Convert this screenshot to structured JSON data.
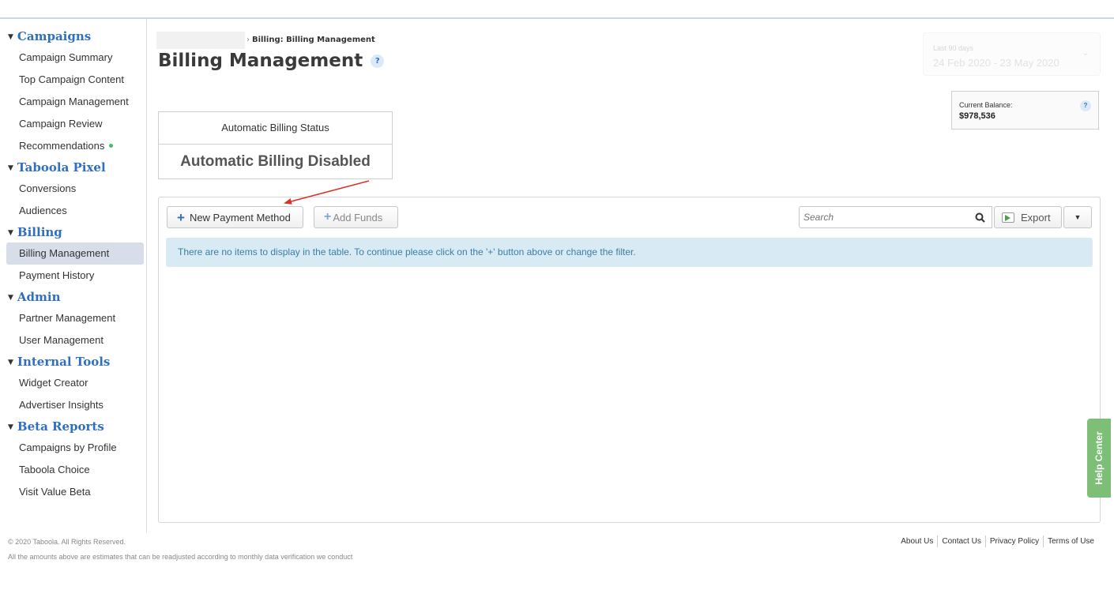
{
  "sidebar": {
    "sections": [
      {
        "title": "Campaigns",
        "items": [
          {
            "label": "Campaign Summary"
          },
          {
            "label": "Top Campaign Content"
          },
          {
            "label": "Campaign Management"
          },
          {
            "label": "Campaign Review"
          },
          {
            "label": "Recommendations"
          }
        ]
      },
      {
        "title": "Taboola Pixel",
        "items": [
          {
            "label": "Conversions"
          },
          {
            "label": "Audiences"
          }
        ]
      },
      {
        "title": "Billing",
        "items": [
          {
            "label": "Billing Management"
          },
          {
            "label": "Payment History"
          }
        ]
      },
      {
        "title": "Admin",
        "items": [
          {
            "label": "Partner Management"
          },
          {
            "label": "User Management"
          }
        ]
      },
      {
        "title": "Internal Tools",
        "items": [
          {
            "label": "Widget Creator"
          },
          {
            "label": "Advertiser Insights"
          }
        ]
      },
      {
        "title": "Beta Reports",
        "items": [
          {
            "label": "Campaigns by Profile"
          },
          {
            "label": "Taboola Choice"
          },
          {
            "label": "Visit Value Beta"
          }
        ]
      }
    ]
  },
  "header": {
    "breadcrumb": "Billing: Billing Management",
    "breadcrumb_sep": "›",
    "title": "Billing Management",
    "help": "?"
  },
  "date_range": {
    "label": "Last 90 days",
    "value": "24 Feb 2020 - 23 May 2020"
  },
  "balance": {
    "label": "Current Balance:",
    "value": "$978,536",
    "help": "?"
  },
  "billing_status": {
    "heading": "Automatic Billing Status",
    "value": "Automatic Billing Disabled"
  },
  "toolbar": {
    "new_payment_label": "New Payment Method",
    "add_funds_label": "Add Funds",
    "search_placeholder": "Search",
    "export_label": "Export"
  },
  "table": {
    "empty_message": "There are no items to display in the table. To continue please click on the '+' button above or change the filter."
  },
  "help_center": "Help Center",
  "footer": {
    "copyright": "© 2020 Taboola. All Rights Reserved.",
    "note": "All the amounts above are estimates that can be readjusted according to monthly data verification we conduct",
    "links": [
      "About Us",
      "Contact Us",
      "Privacy Policy",
      "Terms of Use"
    ]
  },
  "colors": {
    "link_blue": "#2f6fc1",
    "active_bg": "#d7dee9",
    "info_bg": "#d8eaf4",
    "annotation_red": "#e0302a",
    "help_green": "#7dbf76"
  }
}
